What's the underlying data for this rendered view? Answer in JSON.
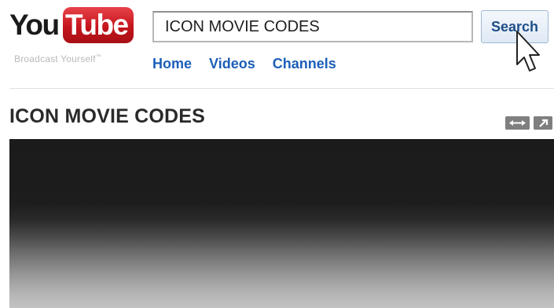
{
  "logo": {
    "word_you": "You",
    "word_tube": "Tube",
    "tagline": "Broadcast Yourself",
    "tagline_mark": "™"
  },
  "search": {
    "value": "ICON MOVIE CODES",
    "button_label": "Search"
  },
  "nav": {
    "items": [
      {
        "label": "Home"
      },
      {
        "label": "Videos"
      },
      {
        "label": "Channels"
      }
    ]
  },
  "video": {
    "title": "ICON MOVIE CODES"
  },
  "controls": {
    "expand_icon": "expand-arrows-icon",
    "popout_icon": "popout-arrow-icon"
  },
  "colors": {
    "brand_red": "#c5141c",
    "link_blue": "#1d5fb8",
    "button_text": "#1f4f88"
  }
}
